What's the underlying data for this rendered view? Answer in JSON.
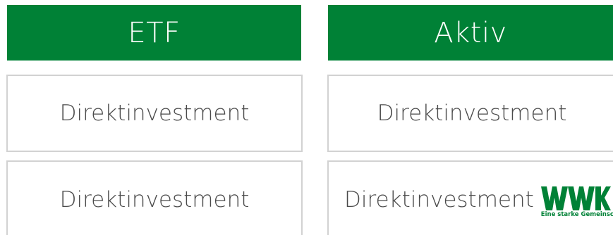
{
  "colors": {
    "header_bg": "#008136",
    "header_text": "#ffffff",
    "cell_border": "#d2d2d2",
    "cell_text": "#4a4a4a",
    "logo_green": "#008136"
  },
  "columns": [
    {
      "header": "ETF",
      "rows": [
        "Direktinvestment",
        "Direktinvestment"
      ]
    },
    {
      "header": "Aktiv",
      "rows": [
        "Direktinvestment",
        "Direktinvestment"
      ]
    }
  ],
  "logo": {
    "name": "WWK",
    "tagline": "Eine starke Gemeinschaft"
  }
}
